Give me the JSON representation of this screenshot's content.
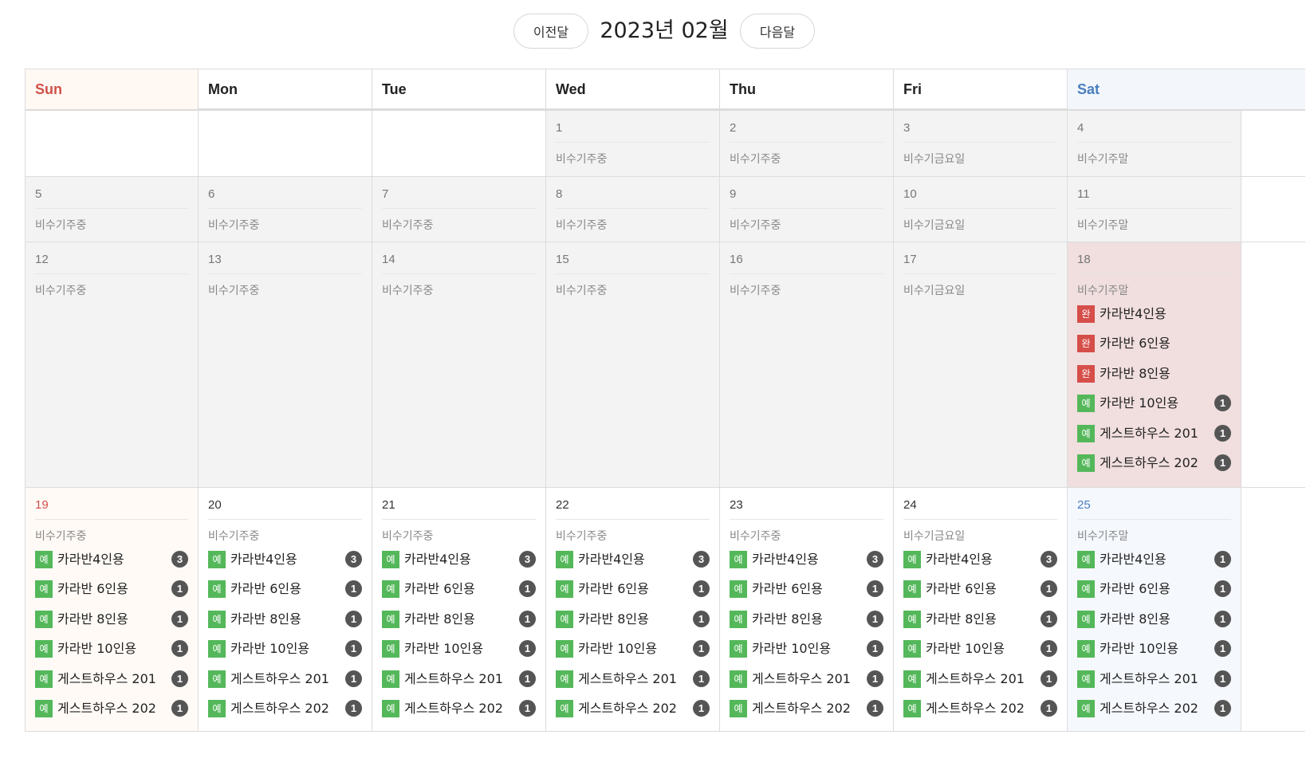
{
  "nav": {
    "prev_label": "이전달",
    "next_label": "다음달",
    "month_title": "2023년 02월"
  },
  "headers": [
    "Sun",
    "Mon",
    "Tue",
    "Wed",
    "Thu",
    "Fri",
    "Sat"
  ],
  "item_badges": {
    "available": "예",
    "full": "완"
  },
  "weeks": [
    {
      "days": [
        null,
        null,
        null,
        {
          "day": "1",
          "season": "비수기주중",
          "items": []
        },
        {
          "day": "2",
          "season": "비수기주중",
          "items": []
        },
        {
          "day": "3",
          "season": "비수기금요일",
          "items": []
        },
        {
          "day": "4",
          "season": "비수기주말",
          "items": []
        }
      ]
    },
    {
      "days": [
        {
          "day": "5",
          "season": "비수기주중",
          "items": []
        },
        {
          "day": "6",
          "season": "비수기주중",
          "items": []
        },
        {
          "day": "7",
          "season": "비수기주중",
          "items": []
        },
        {
          "day": "8",
          "season": "비수기주중",
          "items": []
        },
        {
          "day": "9",
          "season": "비수기주중",
          "items": []
        },
        {
          "day": "10",
          "season": "비수기금요일",
          "items": []
        },
        {
          "day": "11",
          "season": "비수기주말",
          "items": []
        }
      ]
    },
    {
      "days": [
        {
          "day": "12",
          "season": "비수기주중",
          "items": []
        },
        {
          "day": "13",
          "season": "비수기주중",
          "items": []
        },
        {
          "day": "14",
          "season": "비수기주중",
          "items": []
        },
        {
          "day": "15",
          "season": "비수기주중",
          "items": []
        },
        {
          "day": "16",
          "season": "비수기주중",
          "items": []
        },
        {
          "day": "17",
          "season": "비수기금요일",
          "items": []
        },
        {
          "day": "18",
          "season": "비수기주말",
          "items": [
            {
              "status": "full",
              "name": "카라반4인용",
              "count": ""
            },
            {
              "status": "full",
              "name": "카라반 6인용",
              "count": ""
            },
            {
              "status": "full",
              "name": "카라반 8인용",
              "count": ""
            },
            {
              "status": "available",
              "name": "카라반 10인용",
              "count": "1"
            },
            {
              "status": "available",
              "name": "게스트하우스 201",
              "count": "1"
            },
            {
              "status": "available",
              "name": "게스트하우스 202",
              "count": "1"
            }
          ]
        }
      ]
    },
    {
      "days": [
        {
          "day": "19",
          "season": "비수기주중",
          "items": [
            {
              "status": "available",
              "name": "카라반4인용",
              "count": "3"
            },
            {
              "status": "available",
              "name": "카라반 6인용",
              "count": "1"
            },
            {
              "status": "available",
              "name": "카라반 8인용",
              "count": "1"
            },
            {
              "status": "available",
              "name": "카라반 10인용",
              "count": "1"
            },
            {
              "status": "available",
              "name": "게스트하우스 201",
              "count": "1"
            },
            {
              "status": "available",
              "name": "게스트하우스 202",
              "count": "1"
            }
          ]
        },
        {
          "day": "20",
          "season": "비수기주중",
          "items": [
            {
              "status": "available",
              "name": "카라반4인용",
              "count": "3"
            },
            {
              "status": "available",
              "name": "카라반 6인용",
              "count": "1"
            },
            {
              "status": "available",
              "name": "카라반 8인용",
              "count": "1"
            },
            {
              "status": "available",
              "name": "카라반 10인용",
              "count": "1"
            },
            {
              "status": "available",
              "name": "게스트하우스 201",
              "count": "1"
            },
            {
              "status": "available",
              "name": "게스트하우스 202",
              "count": "1"
            }
          ]
        },
        {
          "day": "21",
          "season": "비수기주중",
          "items": [
            {
              "status": "available",
              "name": "카라반4인용",
              "count": "3"
            },
            {
              "status": "available",
              "name": "카라반 6인용",
              "count": "1"
            },
            {
              "status": "available",
              "name": "카라반 8인용",
              "count": "1"
            },
            {
              "status": "available",
              "name": "카라반 10인용",
              "count": "1"
            },
            {
              "status": "available",
              "name": "게스트하우스 201",
              "count": "1"
            },
            {
              "status": "available",
              "name": "게스트하우스 202",
              "count": "1"
            }
          ]
        },
        {
          "day": "22",
          "season": "비수기주중",
          "items": [
            {
              "status": "available",
              "name": "카라반4인용",
              "count": "3"
            },
            {
              "status": "available",
              "name": "카라반 6인용",
              "count": "1"
            },
            {
              "status": "available",
              "name": "카라반 8인용",
              "count": "1"
            },
            {
              "status": "available",
              "name": "카라반 10인용",
              "count": "1"
            },
            {
              "status": "available",
              "name": "게스트하우스 201",
              "count": "1"
            },
            {
              "status": "available",
              "name": "게스트하우스 202",
              "count": "1"
            }
          ]
        },
        {
          "day": "23",
          "season": "비수기주중",
          "items": [
            {
              "status": "available",
              "name": "카라반4인용",
              "count": "3"
            },
            {
              "status": "available",
              "name": "카라반 6인용",
              "count": "1"
            },
            {
              "status": "available",
              "name": "카라반 8인용",
              "count": "1"
            },
            {
              "status": "available",
              "name": "카라반 10인용",
              "count": "1"
            },
            {
              "status": "available",
              "name": "게스트하우스 201",
              "count": "1"
            },
            {
              "status": "available",
              "name": "게스트하우스 202",
              "count": "1"
            }
          ]
        },
        {
          "day": "24",
          "season": "비수기금요일",
          "items": [
            {
              "status": "available",
              "name": "카라반4인용",
              "count": "3"
            },
            {
              "status": "available",
              "name": "카라반 6인용",
              "count": "1"
            },
            {
              "status": "available",
              "name": "카라반 8인용",
              "count": "1"
            },
            {
              "status": "available",
              "name": "카라반 10인용",
              "count": "1"
            },
            {
              "status": "available",
              "name": "게스트하우스 201",
              "count": "1"
            },
            {
              "status": "available",
              "name": "게스트하우스 202",
              "count": "1"
            }
          ]
        },
        {
          "day": "25",
          "season": "비수기주말",
          "items": [
            {
              "status": "available",
              "name": "카라반4인용",
              "count": "1"
            },
            {
              "status": "available",
              "name": "카라반 6인용",
              "count": "1"
            },
            {
              "status": "available",
              "name": "카라반 8인용",
              "count": "1"
            },
            {
              "status": "available",
              "name": "카라반 10인용",
              "count": "1"
            },
            {
              "status": "available",
              "name": "게스트하우스 201",
              "count": "1"
            },
            {
              "status": "available",
              "name": "게스트하우스 202",
              "count": "1"
            }
          ]
        }
      ]
    }
  ],
  "colors": {
    "available_badge": "#54b85a",
    "full_badge": "#d64e4a",
    "sunday_text": "#d0504a",
    "saturday_text": "#4a7fc0",
    "selected_day_bg": "#f1dede",
    "past_day_bg": "#f3f3f3"
  }
}
